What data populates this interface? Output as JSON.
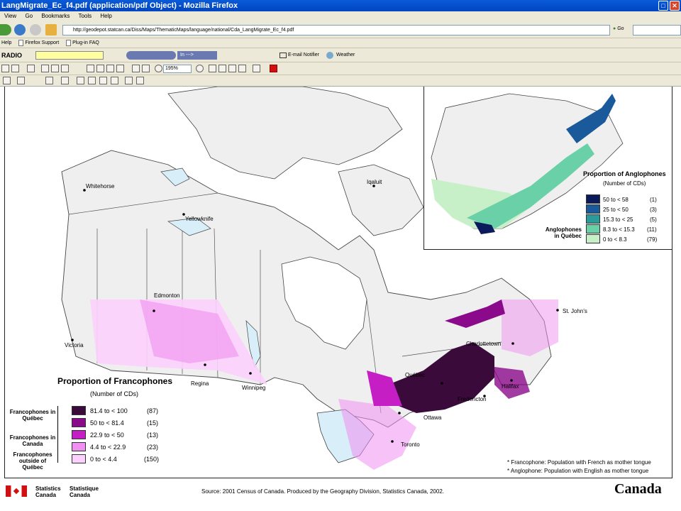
{
  "window": {
    "title": "LangMigrate_Ec_f4.pdf (application/pdf Object) - Mozilla Firefox"
  },
  "menu": [
    "View",
    "Go",
    "Bookmarks",
    "Tools",
    "Help"
  ],
  "nav": {
    "url": "http://geodepot.statcan.ca/Diss/Maps/ThematicMaps/language/national/Cda_LangMigrate_Ec_f4.pdf",
    "go_label": "Go"
  },
  "bookmarks": [
    "Help",
    "Firefox Support",
    "Plug-in FAQ"
  ],
  "radio_toolbar": {
    "radio_label": "RADIO",
    "stream_label": "In --->",
    "email_label": "E-mail Notifier",
    "weather_label": "Weather"
  },
  "pdf_toolbar": {
    "zoom": "195%"
  },
  "map": {
    "cities": [
      "Whitehorse",
      "Yellowknife",
      "Iqaluit",
      "Edmonton",
      "Victoria",
      "Regina",
      "Winnipeg",
      "St. John's",
      "Charlottetown",
      "Québec",
      "Halifax",
      "Fredericton",
      "Ottawa",
      "Toronto"
    ],
    "franco_legend": {
      "title": "Proportion of Francophones",
      "subtitle": "(Number of CDs)",
      "groups": [
        "Francophones in Québec",
        "Francophones in Canada",
        "Francophones outside of Québec"
      ],
      "rows": [
        {
          "range": "81.4 to < 100",
          "count": "(87)",
          "color": "#3a0a3a"
        },
        {
          "range": "50 to < 81.4",
          "count": "(15)",
          "color": "#8b0a8b"
        },
        {
          "range": "22.9 to < 50",
          "count": "(13)",
          "color": "#c41ec4"
        },
        {
          "range": "4.4 to < 22.9",
          "count": "(23)",
          "color": "#f090f0"
        },
        {
          "range": "0 to < 4.4",
          "count": "(150)",
          "color": "#fcd0fc"
        }
      ]
    },
    "anglo_legend": {
      "title": "Proportion of Anglophones",
      "subtitle": "(Number of CDs)",
      "group": "Anglophones in Québec",
      "rows": [
        {
          "range": "50 to < 58",
          "count": "(1)",
          "color": "#0a1a5a"
        },
        {
          "range": "25 to < 50",
          "count": "(3)",
          "color": "#1a5a9a"
        },
        {
          "range": "15.3 to < 25",
          "count": "(5)",
          "color": "#2a9a9a"
        },
        {
          "range": "8.3 to < 15.3",
          "count": "(11)",
          "color": "#6ad0a8"
        },
        {
          "range": "0 to < 8.3",
          "count": "(79)",
          "color": "#c8f0c8"
        }
      ]
    },
    "notes": [
      "* Francophone: Population with French as mother tongue",
      "* Anglophone: Population with English as mother tongue"
    ]
  },
  "footer": {
    "statcan_en": "Statistics Canada",
    "statcan_fr": "Statistique Canada",
    "source": "Source:  2001 Census of Canada.  Produced by the Geography Division, Statistics Canada, 2002.",
    "wordmark": "Canada"
  }
}
